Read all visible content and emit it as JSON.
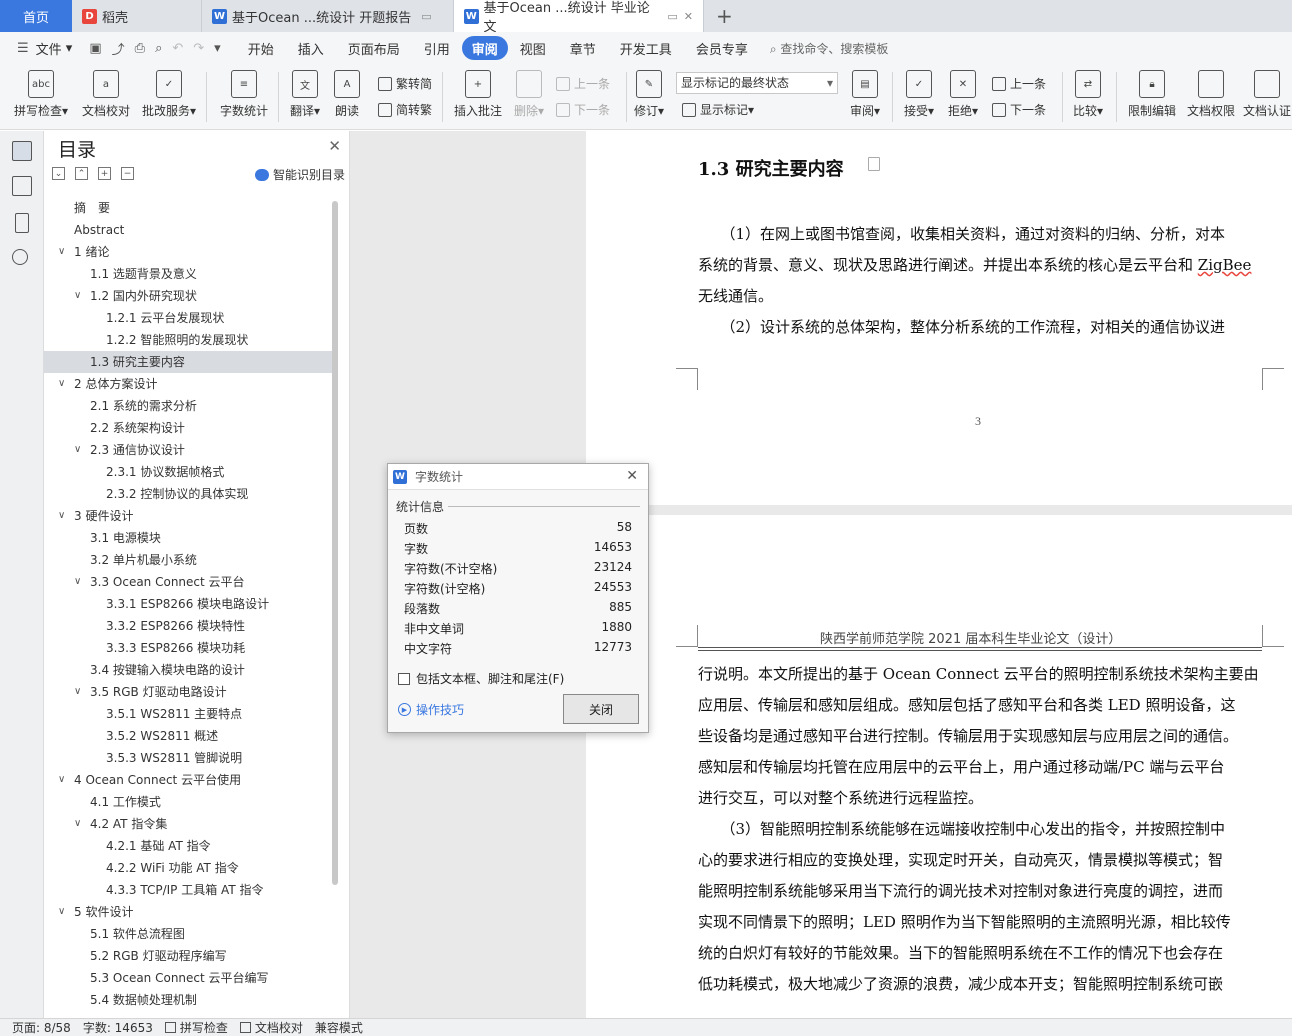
{
  "tabs": {
    "home": "首页",
    "t1": "稻壳",
    "t2": "基于Ocean ...统设计 开题报告",
    "t3": "基于Ocean ...统设计 毕业论文"
  },
  "menu": {
    "file": "文件",
    "items": [
      "开始",
      "插入",
      "页面布局",
      "引用",
      "审阅",
      "视图",
      "章节",
      "开发工具",
      "会员专享"
    ],
    "search": "查找命令、搜索模板"
  },
  "ribbon": {
    "spell": "拼写检查",
    "proof": "文档校对",
    "batch": "批改服务",
    "wordcount": "字数统计",
    "translate": "翻译",
    "read": "朗读",
    "trad": "繁转简",
    "simp": "简转繁",
    "insert_comment": "插入批注",
    "delete": "删除",
    "prev": "上一条",
    "next": "下一条",
    "revise": "修订",
    "markup_select": "显示标记的最终状态",
    "show_markup": "显示标记",
    "review": "审阅",
    "accept": "接受",
    "reject": "拒绝",
    "prev2": "上一条",
    "next2": "下一条",
    "compare": "比较",
    "restrict": "限制编辑",
    "perm": "文档权限",
    "cert": "文档认证"
  },
  "toc": {
    "title": "目录",
    "smart": "智能识别目录",
    "items": [
      {
        "text": "摘　要",
        "level": 0,
        "arrow": ""
      },
      {
        "text": "Abstract",
        "level": 0,
        "arrow": ""
      },
      {
        "text": "1  绪论",
        "level": 0,
        "arrow": "v"
      },
      {
        "text": "1.1 选题背景及意义",
        "level": 1,
        "arrow": ""
      },
      {
        "text": "1.2 国内外研究现状",
        "level": 1,
        "arrow": "v"
      },
      {
        "text": "1.2.1 云平台发展现状",
        "level": 2,
        "arrow": ""
      },
      {
        "text": "1.2.2 智能照明的发展现状",
        "level": 2,
        "arrow": ""
      },
      {
        "text": "1.3  研究主要内容",
        "level": 1,
        "arrow": "",
        "selected": true
      },
      {
        "text": "2  总体方案设计",
        "level": 0,
        "arrow": "v"
      },
      {
        "text": "2.1  系统的需求分析",
        "level": 1,
        "arrow": ""
      },
      {
        "text": "2.2  系统架构设计",
        "level": 1,
        "arrow": ""
      },
      {
        "text": "2.3  通信协议设计",
        "level": 1,
        "arrow": "v"
      },
      {
        "text": "2.3.1 协议数据帧格式",
        "level": 2,
        "arrow": ""
      },
      {
        "text": "2.3.2 控制协议的具体实现",
        "level": 2,
        "arrow": ""
      },
      {
        "text": "3  硬件设计",
        "level": 0,
        "arrow": "v"
      },
      {
        "text": "3.1  电源模块",
        "level": 1,
        "arrow": ""
      },
      {
        "text": "3.2  单片机最小系统",
        "level": 1,
        "arrow": ""
      },
      {
        "text": "3.3 Ocean Connect 云平台",
        "level": 1,
        "arrow": "v"
      },
      {
        "text": "3.3.1 ESP8266 模块电路设计",
        "level": 2,
        "arrow": ""
      },
      {
        "text": "3.3.2 ESP8266 模块特性",
        "level": 2,
        "arrow": ""
      },
      {
        "text": "3.3.3 ESP8266 模块功耗",
        "level": 2,
        "arrow": ""
      },
      {
        "text": "3.4  按键输入模块电路的设计",
        "level": 1,
        "arrow": ""
      },
      {
        "text": "3.5 RGB  灯驱动电路设计",
        "level": 1,
        "arrow": "v"
      },
      {
        "text": "3.5.1 WS2811 主要特点",
        "level": 2,
        "arrow": ""
      },
      {
        "text": "3.5.2 WS2811 概述",
        "level": 2,
        "arrow": ""
      },
      {
        "text": "3.5.3 WS2811 管脚说明",
        "level": 2,
        "arrow": ""
      },
      {
        "text": "4 Ocean Connect 云平台使用",
        "level": 0,
        "arrow": "v"
      },
      {
        "text": "4.1  工作模式",
        "level": 1,
        "arrow": ""
      },
      {
        "text": "4.2 AT 指令集",
        "level": 1,
        "arrow": "v"
      },
      {
        "text": "4.2.1  基础 AT 指令",
        "level": 2,
        "arrow": ""
      },
      {
        "text": "4.2.2 WiFi 功能 AT 指令",
        "level": 2,
        "arrow": ""
      },
      {
        "text": "4.3.3 TCP/IP 工具箱  AT 指令",
        "level": 2,
        "arrow": ""
      },
      {
        "text": "5  软件设计",
        "level": 0,
        "arrow": "v"
      },
      {
        "text": "5.1 软件总流程图",
        "level": 1,
        "arrow": ""
      },
      {
        "text": "5.2 RGB 灯驱动程序编写",
        "level": 1,
        "arrow": ""
      },
      {
        "text": "5.3 Ocean Connect 云平台编写",
        "level": 1,
        "arrow": ""
      },
      {
        "text": "5.4 数据帧处理机制",
        "level": 1,
        "arrow": ""
      }
    ]
  },
  "doc": {
    "heading": "1.3  研究主要内容",
    "p1_lines": [
      "　　（1）在网上或图书馆查阅，收集相关资料，通过对资料的归纳、分析，对本",
      "系统的背景、意义、现状及思路进行阐述。并提出本系统的核心是云平台和 ",
      "无线通信。",
      "　　（2）设计系统的总体架构，整体分析系统的工作流程，对相关的通信协议进"
    ],
    "zigbee": "ZigBee",
    "page_number": "3",
    "page_header": "陕西学前师范学院  2021 届本科生毕业论文（设计）",
    "p2_lines": [
      "行说明。本文所提出的基于 Ocean Connect 云平台的照明控制系统技术架构主要由",
      "应用层、传输层和感知层组成。感知层包括了感知平台和各类 LED 照明设备，这",
      "些设备均是通过感知平台进行控制。传输层用于实现感知层与应用层之间的通信。",
      "感知层和传输层均托管在应用层中的云平台上，用户通过移动端/PC 端与云平台",
      "进行交互，可以对整个系统进行远程监控。",
      "　　（3）智能照明控制系统能够在远端接收控制中心发出的指令，并按照控制中",
      "心的要求进行相应的变换处理，实现定时开关，自动亮灭，情景模拟等模式；智",
      "能照明控制系统能够采用当下流行的调光技术对控制对象进行亮度的调控，进而",
      "实现不同情景下的照明；LED  照明作为当下智能照明的主流照明光源，相比较传",
      "统的白炽灯有较好的节能效果。当下的智能照明系统在不工作的情况下也会存在",
      "低功耗模式，极大地减少了资源的浪费，减少成本开支；智能照明控制系统可嵌"
    ]
  },
  "dialog": {
    "title": "字数统计",
    "section": "统计信息",
    "rows": [
      {
        "label": "页数",
        "value": "58"
      },
      {
        "label": "字数",
        "value": "14653"
      },
      {
        "label": "字符数(不计空格)",
        "value": "23124"
      },
      {
        "label": "字符数(计空格)",
        "value": "24553"
      },
      {
        "label": "段落数",
        "value": "885"
      },
      {
        "label": "非中文单词",
        "value": "1880"
      },
      {
        "label": "中文字符",
        "value": "12773"
      }
    ],
    "checkbox": "包括文本框、脚注和尾注(F)",
    "tips": "操作技巧",
    "close": "关闭"
  },
  "status": {
    "page": "页面: 8/58",
    "words": "字数: 14653",
    "spell": "拼写检查",
    "proof": "文档校对",
    "compat": "兼容模式"
  }
}
